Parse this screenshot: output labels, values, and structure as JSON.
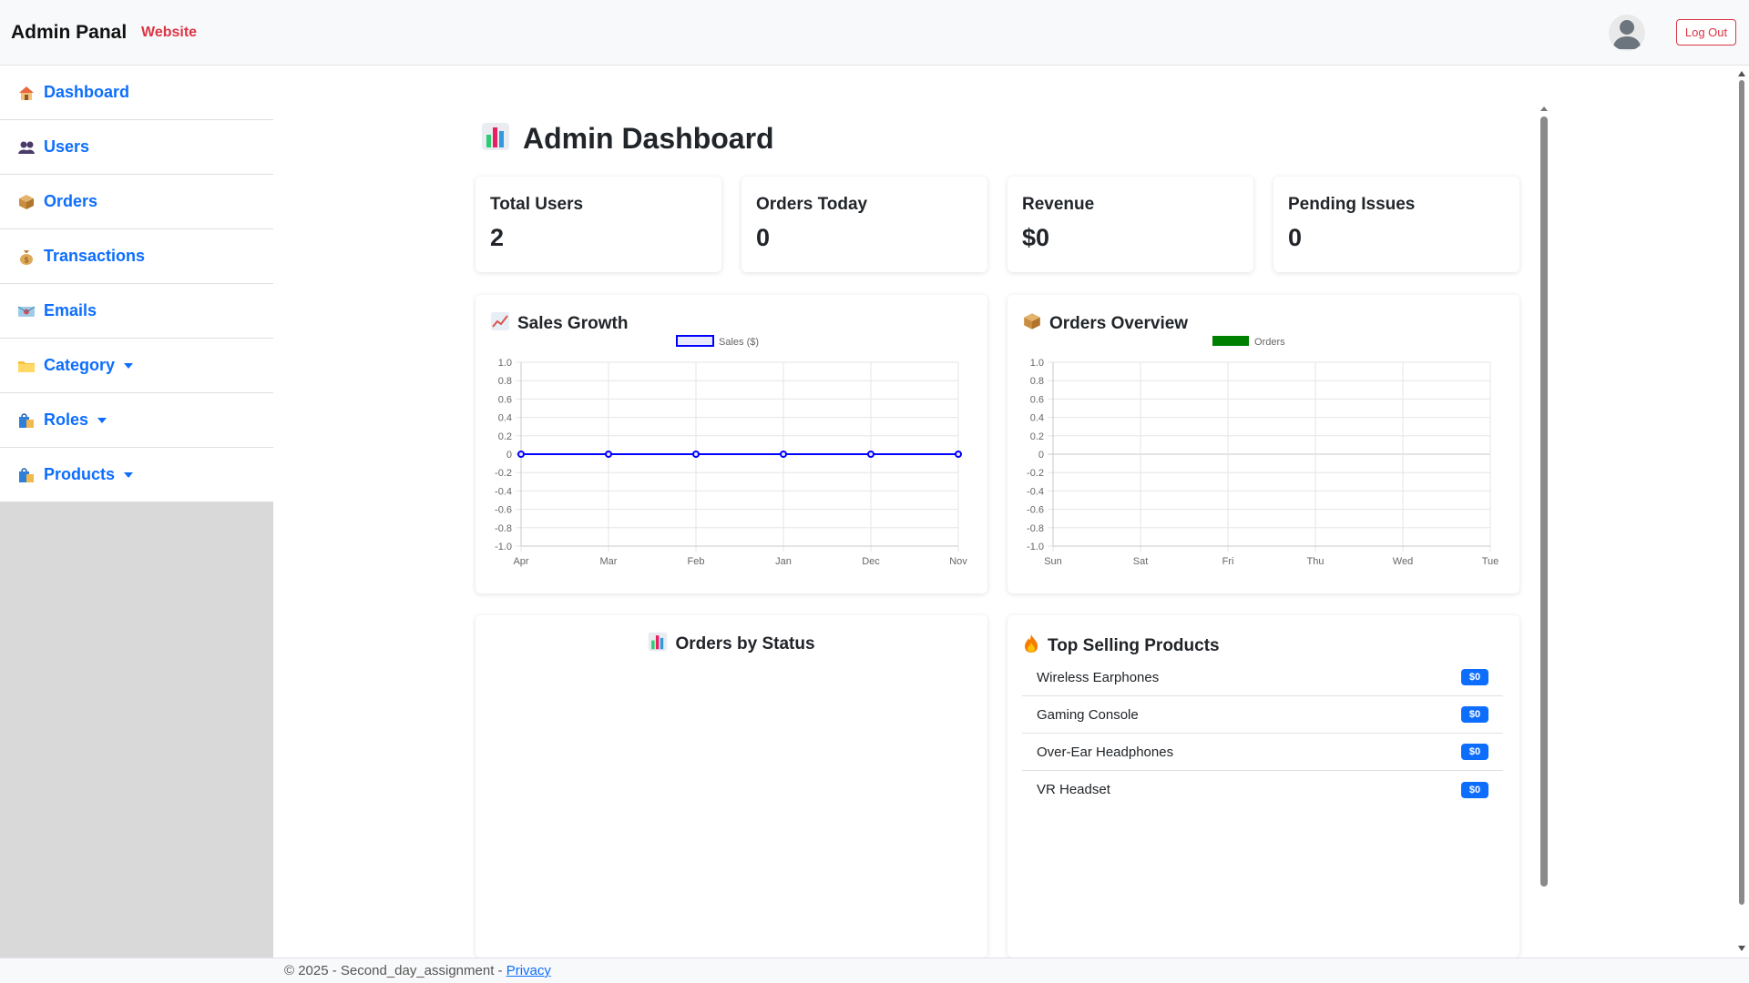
{
  "navbar": {
    "brand": "Admin Panal",
    "website_link": "Website",
    "logout_label": "Log Out"
  },
  "sidebar": {
    "items": [
      {
        "label": "Dashboard",
        "icon": "house-icon"
      },
      {
        "label": "Users",
        "icon": "users-icon"
      },
      {
        "label": "Orders",
        "icon": "package-icon"
      },
      {
        "label": "Transactions",
        "icon": "money-bag-icon"
      },
      {
        "label": "Emails",
        "icon": "email-icon"
      },
      {
        "label": "Category",
        "icon": "folder-icon",
        "dropdown": true
      },
      {
        "label": "Roles",
        "icon": "shopping-bags-icon",
        "dropdown": true
      },
      {
        "label": "Products",
        "icon": "shopping-bags-icon",
        "dropdown": true
      }
    ]
  },
  "main": {
    "title": "Admin Dashboard",
    "stats": [
      {
        "label": "Total Users",
        "value": "2"
      },
      {
        "label": "Orders Today",
        "value": "0"
      },
      {
        "label": "Revenue",
        "value": "$0"
      },
      {
        "label": "Pending Issues",
        "value": "0"
      }
    ],
    "sales_growth_title": "Sales Growth",
    "orders_overview_title": "Orders Overview",
    "orders_by_status_title": "Orders by Status",
    "top_products_title": "Top Selling Products",
    "top_products": [
      {
        "name": "Wireless Earphones",
        "price": "$0"
      },
      {
        "name": "Gaming Console",
        "price": "$0"
      },
      {
        "name": "Over-Ear Headphones",
        "price": "$0"
      },
      {
        "name": "VR Headset",
        "price": "$0"
      }
    ]
  },
  "chart_data": [
    {
      "type": "line",
      "title": "Sales Growth",
      "x": [
        "Apr",
        "Mar",
        "Feb",
        "Jan",
        "Dec",
        "Nov"
      ],
      "series": [
        {
          "name": "Sales ($)",
          "values": [
            0,
            0,
            0,
            0,
            0,
            0
          ],
          "color": "#0000ff"
        }
      ],
      "ylim": [
        -1.0,
        1.0
      ],
      "yticks": [
        "1.0",
        "0.8",
        "0.6",
        "0.4",
        "0.2",
        "0",
        "-0.2",
        "-0.4",
        "-0.6",
        "-0.8",
        "-1.0"
      ],
      "grid": true,
      "legend": "top-center"
    },
    {
      "type": "bar",
      "title": "Orders Overview",
      "categories": [
        "Sun",
        "Sat",
        "Fri",
        "Thu",
        "Wed",
        "Tue"
      ],
      "series": [
        {
          "name": "Orders",
          "values": [
            0,
            0,
            0,
            0,
            0,
            0
          ],
          "color": "#008000"
        }
      ],
      "ylim": [
        -1.0,
        1.0
      ],
      "yticks": [
        "1.0",
        "0.8",
        "0.6",
        "0.4",
        "0.2",
        "0",
        "-0.2",
        "-0.4",
        "-0.6",
        "-0.8",
        "-1.0"
      ],
      "grid": true,
      "legend": "top-center"
    }
  ],
  "footer": {
    "text": "© 2025 - Second_day_assignment - ",
    "privacy_link": "Privacy"
  }
}
